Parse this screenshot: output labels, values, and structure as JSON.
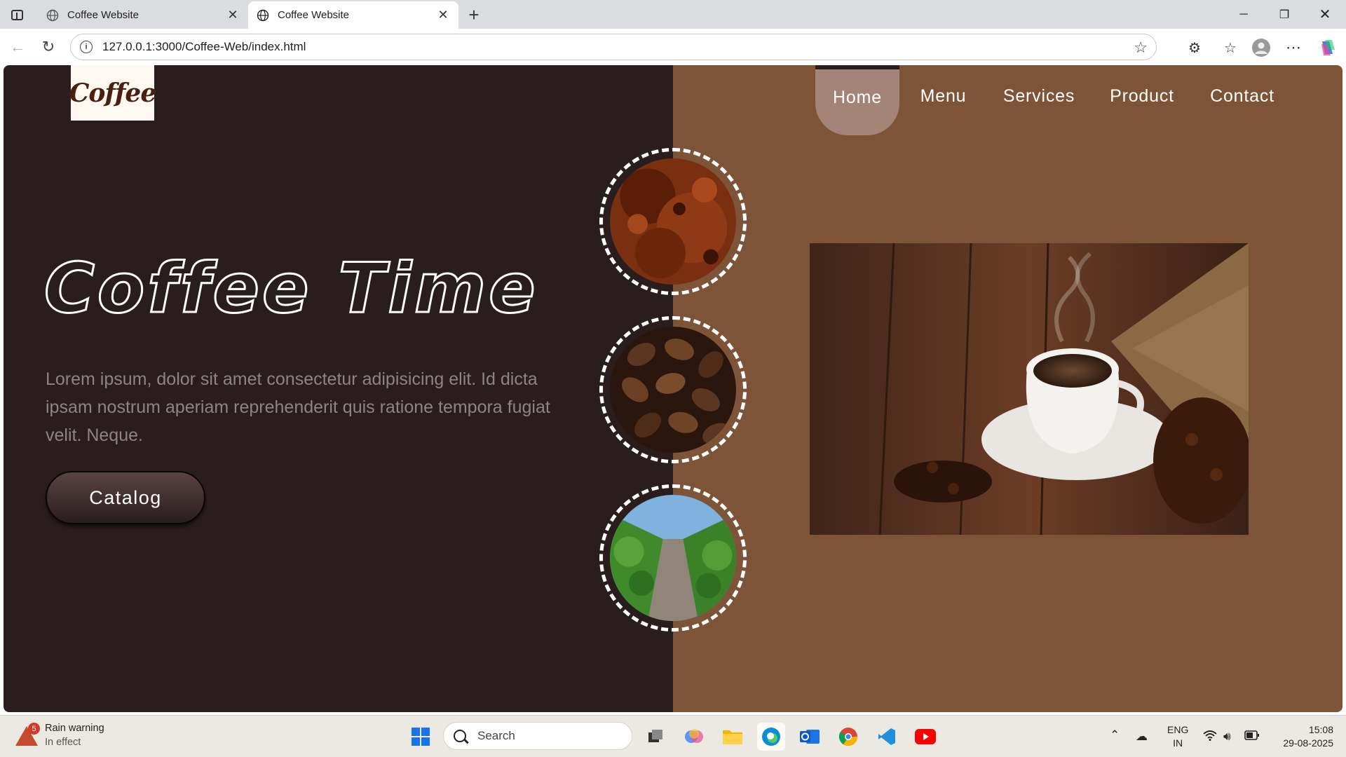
{
  "browser": {
    "tabs": [
      {
        "title": "Coffee Website",
        "active": false
      },
      {
        "title": "Coffee Website",
        "active": true
      }
    ],
    "url": "127.0.0.1:3000/Coffee-Web/index.html"
  },
  "site": {
    "logo_text": "Coffee",
    "nav": [
      "Home",
      "Menu",
      "Services",
      "Product",
      "Contact"
    ],
    "active_nav": "Home",
    "hero_title": "Coffee Time",
    "hero_text": "Lorem ipsum, dolor sit amet consectetur adipisicing elit. Id dicta ipsam nostrum aperiam reprehenderit quis ratione tempora fugiat velit. Neque.",
    "catalog_label": "Catalog",
    "thumbnails": [
      "ground-coffee",
      "coffee-beans",
      "coffee-plantation"
    ],
    "colors": {
      "dark": "#2a1d1e",
      "brown": "#7d5438",
      "nav_active": "#a48477"
    }
  },
  "taskbar": {
    "weather_title": "Rain warning",
    "weather_sub": "In effect",
    "weather_badge": "5",
    "search_label": "Search",
    "lang_top": "ENG",
    "lang_bottom": "IN",
    "time": "15:08",
    "date": "29-08-2025"
  }
}
